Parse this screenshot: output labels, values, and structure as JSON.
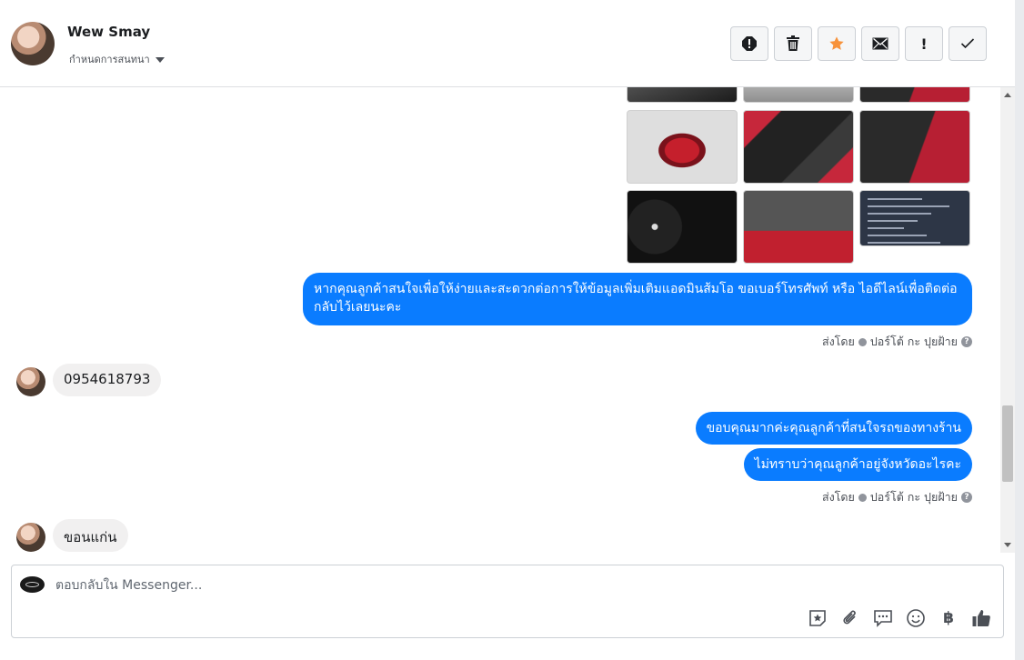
{
  "header": {
    "contact_name": "Wew Smay",
    "subtitle": "กำหนดการสนทนา",
    "actions": [
      {
        "name": "report-icon",
        "label": "!"
      },
      {
        "name": "trash-icon"
      },
      {
        "name": "star-icon",
        "color": "#f7923a"
      },
      {
        "name": "mail-icon"
      },
      {
        "name": "mark-important-icon",
        "label": "!"
      },
      {
        "name": "check-icon"
      }
    ]
  },
  "conversation": {
    "image_tiles": [
      "car-interior",
      "car-exterior",
      "car-seat",
      "car-rear-open",
      "car-rear-seats",
      "car-door-panel",
      "car-dashboard",
      "car-engine",
      "car-document"
    ],
    "messages": [
      {
        "direction": "outgoing",
        "text": "หากคุณลูกค้าสนใจเพื่อให้ง่ายและสะดวกต่อการให้ข้อมูลเพิ่มเติมแอดมินส้มโอ ขอเบอร์โทรศัพท์ หรือ ไอดีไลน์เพื่อติดต่อกลับไว้เลยนะคะ"
      },
      {
        "direction": "incoming",
        "text": "0954618793"
      },
      {
        "direction": "outgoing",
        "text": "ขอบคุณมากค่ะคุณลูกค้าที่สนใจรถของทางร้าน"
      },
      {
        "direction": "outgoing",
        "text": "ไม่ทราบว่าคุณลูกค้าอยู่จังหวัดอะไรคะ"
      },
      {
        "direction": "incoming",
        "text": "ขอนแก่น"
      }
    ],
    "sent_by": {
      "prefix": "ส่งโดย",
      "name": "ปอร์โต้ กะ ปุยฝ้าย",
      "help": "?"
    }
  },
  "composer": {
    "placeholder": "ตอบกลับใน Messenger...",
    "tools": [
      "sticker-icon",
      "attachment-icon",
      "saved-reply-icon",
      "emoji-icon",
      "payment-icon",
      "like-icon"
    ],
    "payment_symbol": "฿",
    "accent": "#4b4f56"
  },
  "colors": {
    "outgoing_bubble": "#0a7cff",
    "incoming_bubble": "#f1f0f0"
  }
}
